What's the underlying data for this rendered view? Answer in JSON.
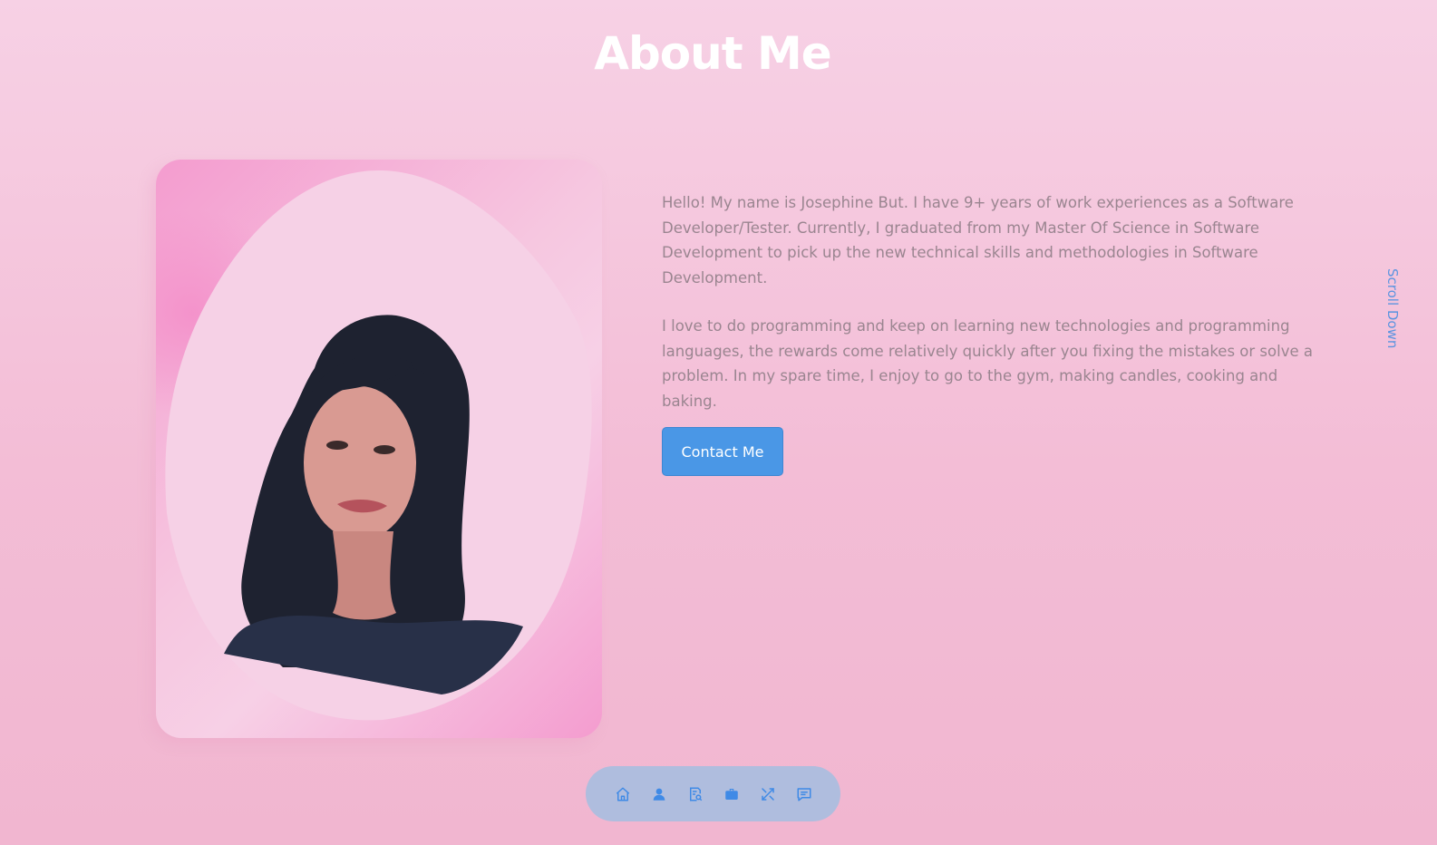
{
  "page": {
    "title": "About Me"
  },
  "about": {
    "paragraphs": [
      "Hello! My name is Josephine But. I have 9+ years of work experiences as a Software Developer/Tester. Currently, I graduated from my Master Of Science in Software Development to pick up the new technical skills and methodologies in Software Development.",
      "I love to do programming and keep on learning new technologies and programming languages, the rewards come relatively quickly after you fixing the mistakes or solve a problem. In my spare time, I enjoy to go to the gym, making candles, cooking and baking."
    ],
    "contact_label": "Contact Me"
  },
  "scroll_down_label": "Scroll Down",
  "nav": {
    "items": [
      {
        "icon": "home-icon"
      },
      {
        "icon": "user-icon"
      },
      {
        "icon": "resume-icon"
      },
      {
        "icon": "briefcase-icon"
      },
      {
        "icon": "tools-icon"
      },
      {
        "icon": "message-icon"
      }
    ]
  },
  "colors": {
    "background": "#f5c6dc",
    "title": "#ffffff",
    "body_text": "#9a8590",
    "accent": "#4a97e6",
    "nav_bar": "#a5bedf",
    "nav_icon": "#3f8ae6"
  }
}
